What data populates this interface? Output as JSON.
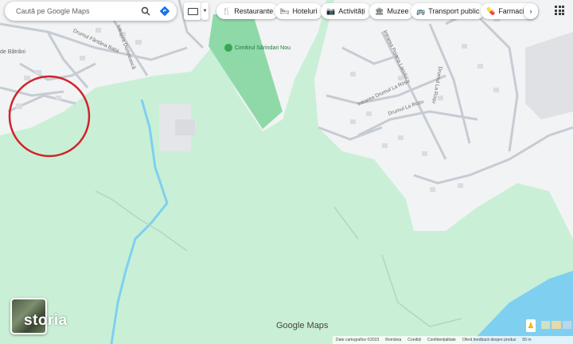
{
  "search": {
    "placeholder": "Caută pe Google Maps"
  },
  "categories": [
    {
      "icon": "fork-knife-icon",
      "label": "Restaurante"
    },
    {
      "icon": "bed-icon",
      "label": "Hoteluri"
    },
    {
      "icon": "camera-icon",
      "label": "Activități"
    },
    {
      "icon": "museum-icon",
      "label": "Muzee"
    },
    {
      "icon": "bus-icon",
      "label": "Transport public"
    },
    {
      "icon": "pharmacy-icon",
      "label": "Farmacii"
    }
  ],
  "places": {
    "cemetery": "Cimitirul Sărindari Nou",
    "village_partial": "de Bătrâni"
  },
  "roads": {
    "fantana_babii": "Drumul Fântâna Babii",
    "domneasca": "Intrarea Domnească",
    "poiana_lacului": "Intrarea Poiana Lacului",
    "drumul_la_rosu": "Drumul La Roșu",
    "intrarea_drumul_la_rosu": "Intrarea Drumul La Roșu",
    "drumul_la_rosu_2": "Drumul La Roșu"
  },
  "branding": {
    "google_maps": "Google Maps",
    "watermark": "storia"
  },
  "footer": {
    "map_data": "Date cartografice ©2023",
    "country": "România",
    "terms": "Condiții",
    "privacy": "Confidențialitate",
    "feedback": "Oferă feedback despre produs",
    "scale": "50 m"
  },
  "colors": {
    "park_green": "#c9f0d6",
    "cemetery_green": "#8fd9a8",
    "urban": "#f2f3f5",
    "water": "#7fd0f0",
    "marker_circle": "#d1222a"
  }
}
